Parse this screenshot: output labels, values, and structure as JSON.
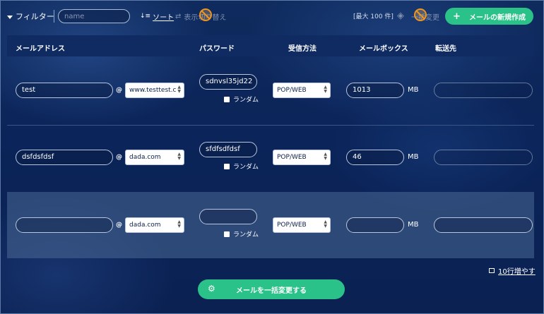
{
  "toolbar": {
    "filter_label": "フィルター",
    "name_placeholder": "name",
    "sort_label": "ソート",
    "display_toggle_label": "表示切り替え",
    "max_label": "[最大 100 件]",
    "bulk_change_label": "一括変更",
    "new_mail_label": "メールの新規作成"
  },
  "table": {
    "headers": [
      "メールアドレス",
      "パスワード",
      "受信方法",
      "メールボックス",
      "転送先"
    ],
    "at": "@",
    "random_label": "ランダム",
    "mb_unit": "MB",
    "rows": [
      {
        "local": "test",
        "domain": "www.testtest.c",
        "password": "sdnvsl35jd22",
        "method": "POP/WEB",
        "mailbox": "1013",
        "forward": ""
      },
      {
        "local": "dsfdsfdsf",
        "domain": "dada.com",
        "password": "sfdfsdfdsf",
        "method": "POP/WEB",
        "mailbox": "46",
        "forward": ""
      },
      {
        "local": "",
        "domain": "dada.com",
        "password": "",
        "method": "POP/WEB",
        "mailbox": "",
        "forward": ""
      }
    ]
  },
  "footer": {
    "add_rows_label": "10行増やす",
    "bulk_update_label": "メールを一括変更する"
  },
  "icons": [
    "filter-icon",
    "sort-icon",
    "swap-icon",
    "no-icon",
    "layers-icon",
    "plus-icon",
    "add-rows-icon",
    "gear-icon"
  ],
  "colors": {
    "accent": "#2bc28a",
    "background": "#0b2459",
    "header": "#0f2b61",
    "warning": "#f0941d"
  }
}
